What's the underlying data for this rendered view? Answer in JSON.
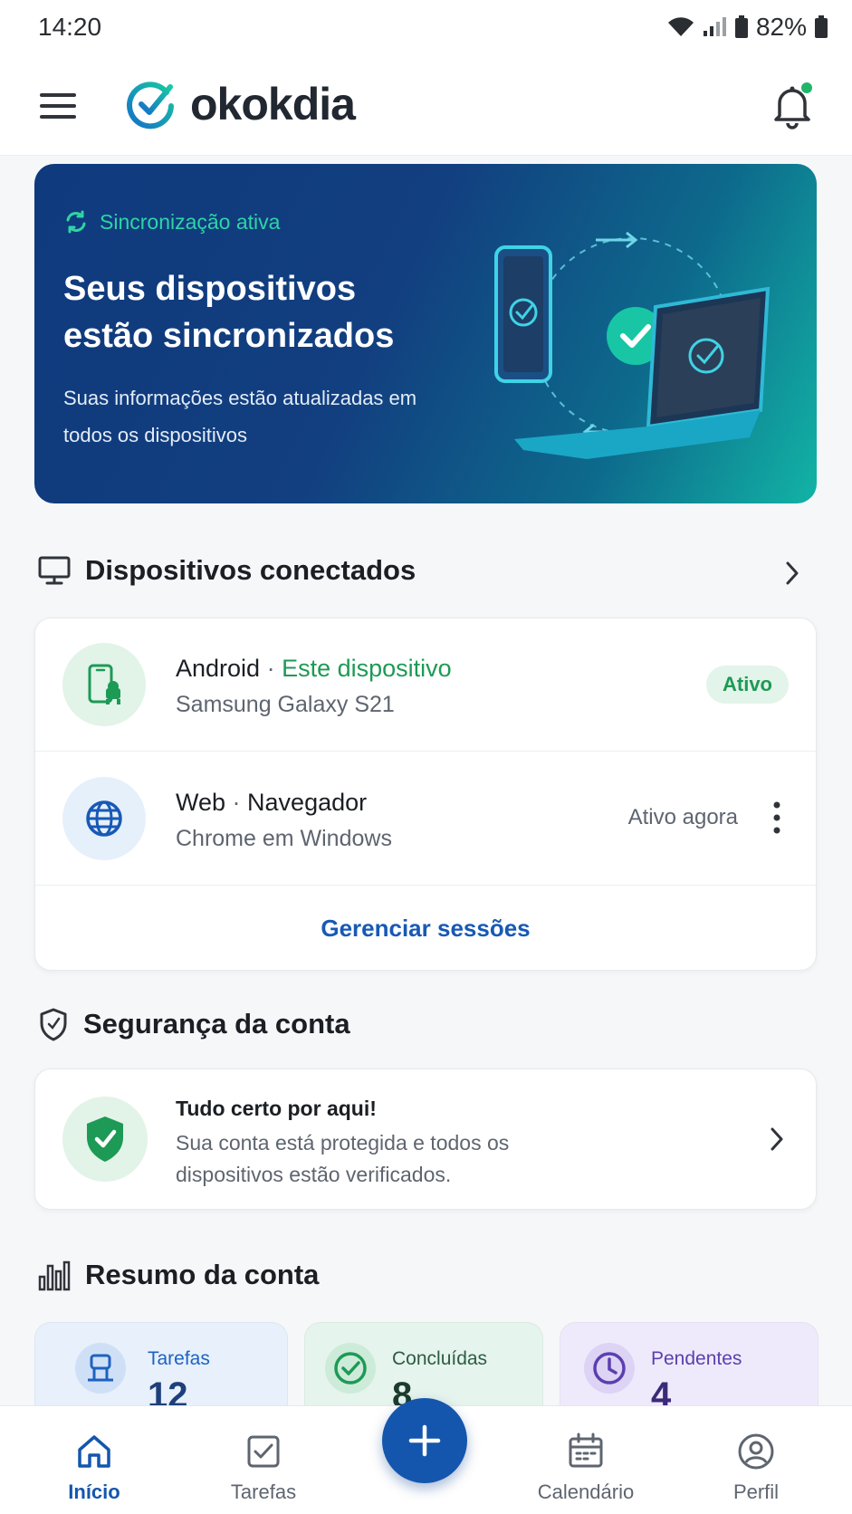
{
  "status_bar": {
    "time": "14:20",
    "battery": "82%"
  },
  "app": {
    "name": "okokdia"
  },
  "hero": {
    "badge": "Sincronização ativa",
    "title": "Seus dispositivos estão sincronizados",
    "subtitle": "Suas informações estão atualizadas em todos os dispositivos"
  },
  "devices": {
    "title": "Dispositivos conectados",
    "items": [
      {
        "name": "Android",
        "tag": "Este dispositivo",
        "detail": "Samsung Galaxy S21",
        "status": "Ativo",
        "icon": "android-phone-icon"
      },
      {
        "name": "Web",
        "tag": "Navegador",
        "detail": "Chrome em Windows",
        "status": "Ativo agora",
        "icon": "globe-icon"
      }
    ],
    "manage_label": "Gerenciar sessões"
  },
  "security": {
    "title": "Segurança da conta",
    "card_title": "Tudo certo por aqui!",
    "card_text": "Sua conta está protegida e todos os dispositivos estão verificados."
  },
  "summary": {
    "title": "Resumo da conta",
    "stats": [
      {
        "label": "Tarefas",
        "value": "12",
        "color": "#1e62c0"
      },
      {
        "label": "Concluídas",
        "value": "8",
        "color": "#1d9a55"
      },
      {
        "label": "Pendentes",
        "value": "4",
        "color": "#5b3fae"
      }
    ]
  },
  "nav": {
    "items": [
      {
        "label": "Início",
        "icon": "home-icon",
        "active": true
      },
      {
        "label": "Tarefas",
        "icon": "task-check-icon",
        "active": false
      },
      {
        "label": "Calendário",
        "icon": "calendar-icon",
        "active": false
      },
      {
        "label": "Perfil",
        "icon": "profile-icon",
        "active": false
      }
    ]
  },
  "colors": {
    "primary": "#1456ad",
    "success": "#1d9a55",
    "accent_teal": "#2ed4a6"
  }
}
